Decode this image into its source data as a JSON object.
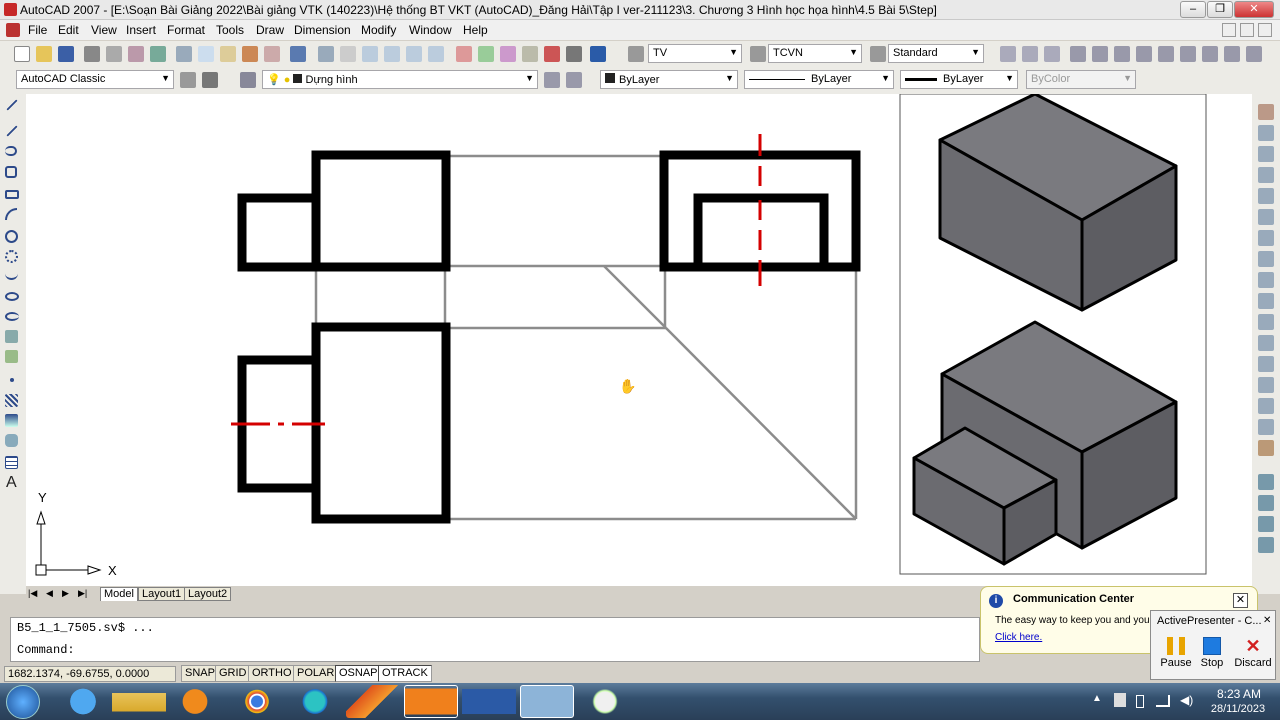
{
  "window": {
    "title": "AutoCAD 2007 - [E:\\Soạn Bài Giảng 2022\\Bài giảng VTK (140223)\\Hệ thống BT VKT (AutoCAD)_Đăng Hải\\Tập I ver-211123\\3. Chương 3 Hình học họa hình\\4.5 Bài 5\\Step]"
  },
  "menu": [
    "File",
    "Edit",
    "View",
    "Insert",
    "Format",
    "Tools",
    "Draw",
    "Dimension",
    "Modify",
    "Window",
    "Help"
  ],
  "toolbar": {
    "textstyle": "TV",
    "dimstyle": "TCVN",
    "tablestyle": "Standard",
    "workspace": "AutoCAD Classic",
    "layer": "Dựng hình",
    "color": "ByLayer",
    "linetype": "ByLayer",
    "lineweight": "ByLayer",
    "plotstyle": "ByColor"
  },
  "ucs": {
    "x": "X",
    "y": "Y"
  },
  "tabs": [
    "Model",
    "Layout1",
    "Layout2"
  ],
  "command": {
    "history": "B5_1_1_7505.sv$ ...",
    "prompt": "Command:"
  },
  "status": {
    "coords": "1682.1374, -69.6755, 0.0000",
    "buttons": [
      "SNAP",
      "GRID",
      "ORTHO",
      "POLAR",
      "OSNAP",
      "OTRACK"
    ]
  },
  "comm_center": {
    "title": "Communication Center",
    "text": "The easy way to keep you and you",
    "link": "Click here."
  },
  "activepresenter": {
    "title": "ActivePresenter - C...",
    "pause": "Pause",
    "stop": "Stop",
    "discard": "Discard"
  },
  "clock": {
    "time": "8:23 AM",
    "date": "28/11/2023"
  },
  "colors": {
    "accent_red": "#d40000",
    "object_fill": "#6b6b70",
    "link": "#0000cc"
  }
}
